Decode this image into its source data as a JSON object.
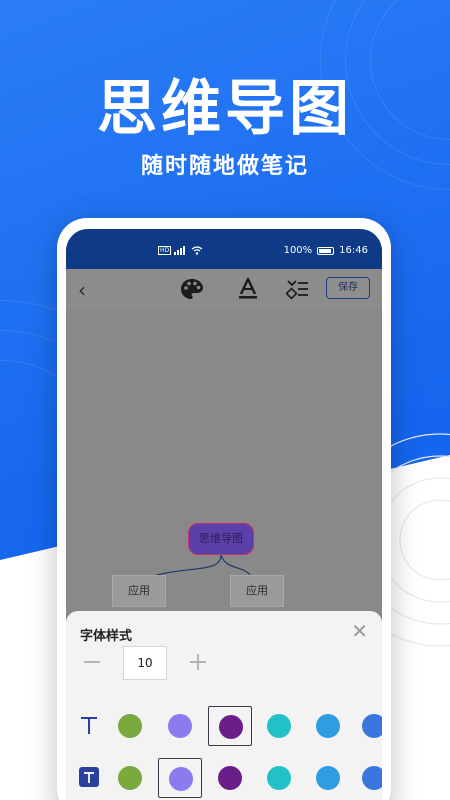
{
  "headline": "思维导图",
  "subline": "随时随地做笔记",
  "status_bar": {
    "left_icons": [
      "hd-icon",
      "signal-icon",
      "wifi-icon"
    ],
    "battery_text": "100%",
    "time": "16:46"
  },
  "toolbar": {
    "back_icon": "chevron-left-icon",
    "icons": [
      "palette-icon",
      "text-color-icon",
      "list-style-icon"
    ],
    "save_label": "保存"
  },
  "mindmap": {
    "root_label": "思维导图",
    "children": [
      "应用",
      "应用"
    ]
  },
  "panel": {
    "title": "字体样式",
    "close_icon": "close-icon",
    "font_size": "10",
    "text_color_row": {
      "icon": "text-t-icon",
      "colors": [
        "#7aa93d",
        "#8a7cf0",
        "#6a1e8a",
        "#21c1c8",
        "#2e9ee0",
        "#3b76e0"
      ],
      "selected_index": 2
    },
    "fill_color_row": {
      "icon": "text-t-filled-icon",
      "colors": [
        "#7aa93d",
        "#8a7cf0",
        "#6a1e8a",
        "#21c1c8",
        "#2e9ee0",
        "#3b76e0"
      ],
      "selected_index": 1
    }
  },
  "colors": {
    "brand_blue": "#1a6df2",
    "status_bar": "#0f3a86"
  }
}
